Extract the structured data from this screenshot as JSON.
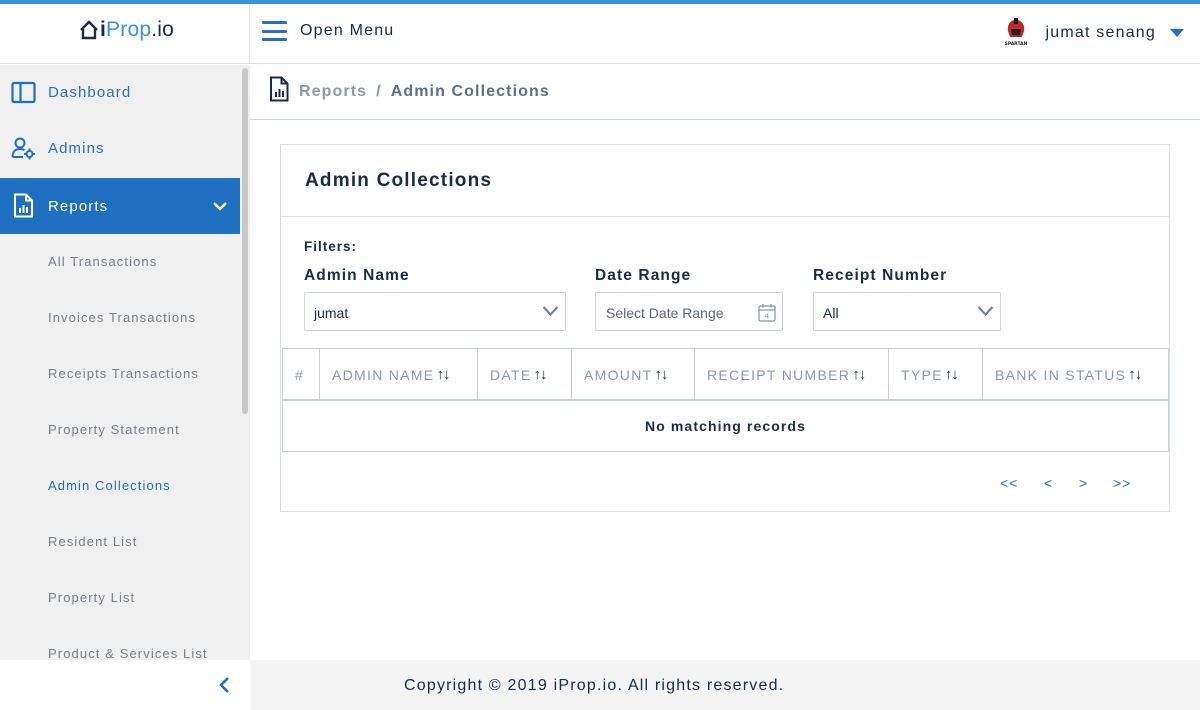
{
  "header": {
    "logo": {
      "part1": "i",
      "part2": "Prop",
      "part3": ".io"
    },
    "menu_label": "Open Menu",
    "user_name": "jumat senang",
    "avatar_text": "SPARTAN"
  },
  "sidebar": {
    "items": [
      {
        "label": "Dashboard",
        "icon": "dashboard-icon"
      },
      {
        "label": "Admins",
        "icon": "admin-gear-icon"
      },
      {
        "label": "Reports",
        "icon": "report-icon",
        "expanded": true
      }
    ],
    "report_subitems": [
      {
        "label": "All Transactions"
      },
      {
        "label": "Invoices Transactions"
      },
      {
        "label": "Receipts Transactions"
      },
      {
        "label": "Property Statement"
      },
      {
        "label": "Admin Collections",
        "active": true
      },
      {
        "label": "Resident List"
      },
      {
        "label": "Property List"
      },
      {
        "label": "Product & Services List"
      }
    ]
  },
  "breadcrumb": {
    "parent": "Reports",
    "separator": "/",
    "current": "Admin Collections"
  },
  "card": {
    "title": "Admin Collections",
    "filters_label": "Filters:",
    "filters": {
      "admin_name": {
        "label": "Admin Name",
        "value": "jumat"
      },
      "date_range": {
        "label": "Date Range",
        "placeholder": "Select Date Range",
        "calendar_day": "4"
      },
      "receipt_number": {
        "label": "Receipt Number",
        "value": "All"
      }
    },
    "table": {
      "columns": [
        "#",
        "ADMIN NAME",
        "DATE",
        "AMOUNT",
        "RECEIPT NUMBER",
        "TYPE",
        "BANK IN STATUS"
      ],
      "sort_glyph": "↑↓",
      "empty_message": "No matching records"
    },
    "pagination": {
      "first": "<<",
      "prev": "<",
      "next": ">",
      "last": ">>"
    }
  },
  "footer": {
    "text": "Copyright © 2019 iProp.io. All rights reserved."
  },
  "colors": {
    "accent": "#1f6fc0",
    "topbar": "#3a93d6",
    "text_dark": "#1b2a47"
  }
}
